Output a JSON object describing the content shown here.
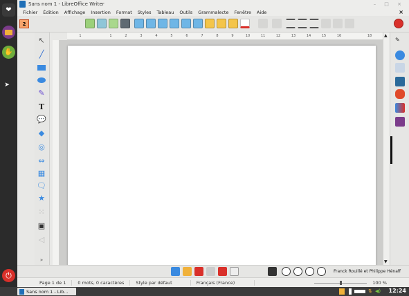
{
  "window": {
    "title": "Sans nom 1 - LibreOffice Writer",
    "controls": "– □ ×"
  },
  "menu": {
    "items": [
      "Fichier",
      "Édition",
      "Affichage",
      "Insertion",
      "Format",
      "Styles",
      "Tableau",
      "Outils",
      "Grammalecte",
      "Fenêtre",
      "Aide"
    ],
    "close": "×"
  },
  "toolbar": {
    "page_number": "2"
  },
  "ruler": {
    "ticks": [
      "1",
      "",
      "1",
      "2",
      "3",
      "4",
      "5",
      "6",
      "7",
      "8",
      "9",
      "10",
      "11",
      "12",
      "13",
      "14",
      "15",
      "16",
      "",
      "18"
    ]
  },
  "credits": {
    "text": "Franck Rouillé et Philippe Hénaff"
  },
  "statusbar": {
    "page": "Page 1 de 1",
    "words": "0 mots, 0 caractères",
    "style": "Style par défaut",
    "language": "Français (France)",
    "zoom": "100 %",
    "zoom_level": 1.0
  },
  "taskbar": {
    "task": "Sans nom 1 - Lib...",
    "time": "12:24"
  },
  "colors": {
    "accent_orange": "#f6a46b",
    "launcher_bg": "#2b2b2b",
    "close_red": "#d9302a"
  }
}
